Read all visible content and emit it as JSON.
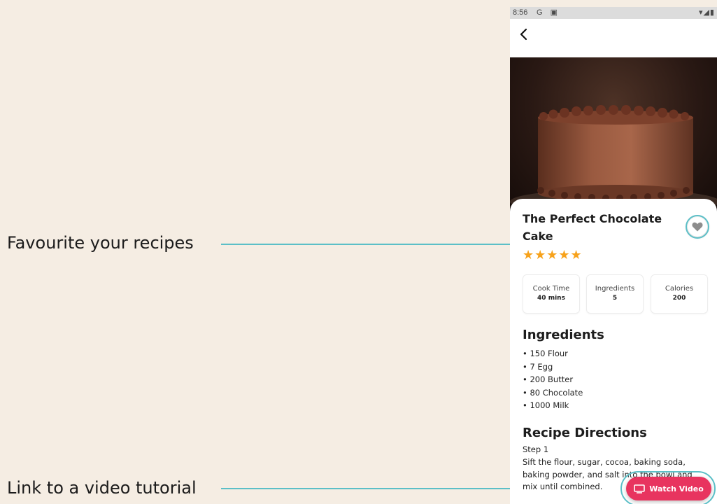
{
  "annotations": {
    "favourite": "Favourite your recipes",
    "video": "Link to a video tutorial"
  },
  "status_bar": {
    "time": "8:56",
    "left_icons": "G ▣",
    "right_icons": "▾◢▮"
  },
  "recipe": {
    "title": "The Perfect Chocolate Cake",
    "rating_stars": "★★★★★",
    "rating": 5,
    "stats": [
      {
        "label": "Cook Time",
        "value": "40 mins"
      },
      {
        "label": "Ingredients",
        "value": "5"
      },
      {
        "label": "Calories",
        "value": "200"
      }
    ],
    "ingredients_title": "Ingredients",
    "ingredients": [
      "• 150 Flour",
      "• 7 Egg",
      "• 200 Butter",
      "• 80 Chocolate",
      "• 1000 Milk"
    ],
    "directions_title": "Recipe Directions",
    "step_label": "Step 1",
    "step_text": "Sift the flour, sugar, cocoa, baking soda, baking powder, and salt into the bowl and mix until combined."
  },
  "buttons": {
    "watch_video": "Watch Video"
  },
  "colors": {
    "background": "#f5ede3",
    "callout": "#5cbfc7",
    "star": "#f7a21b",
    "watch_button": "#e8345f"
  },
  "icons": {
    "back": "chevron-left-icon",
    "favourite": "heart-icon",
    "video": "tv-icon"
  }
}
